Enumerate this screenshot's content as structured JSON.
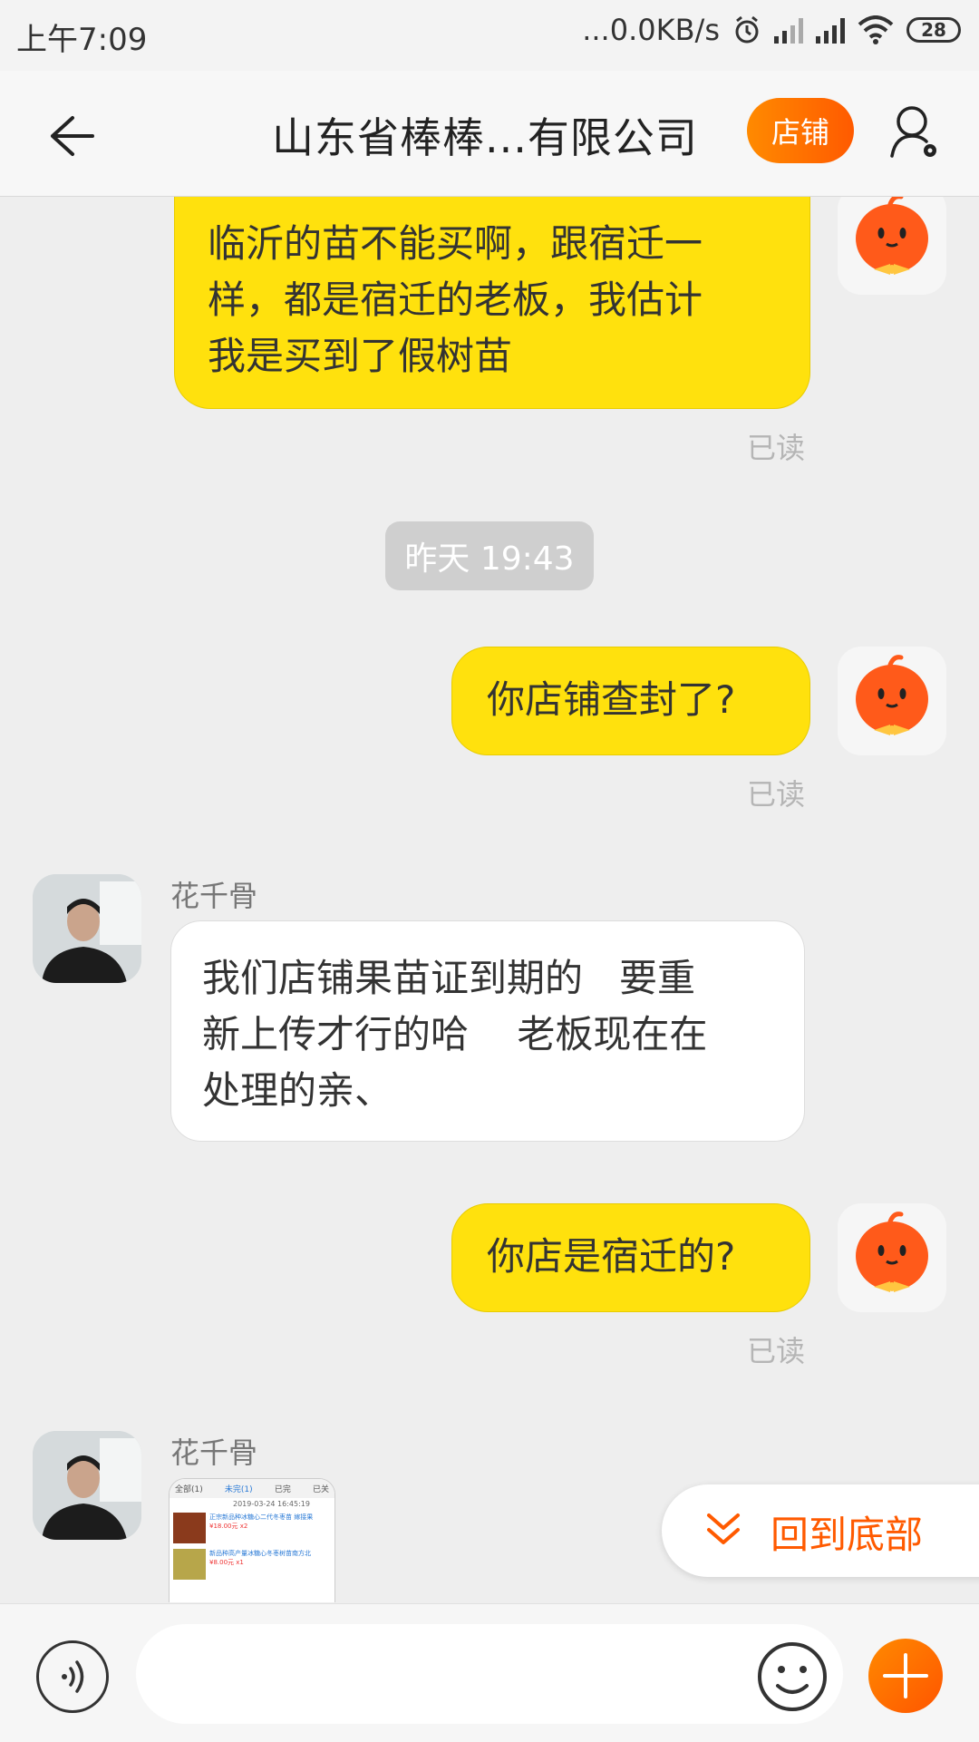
{
  "status_bar": {
    "time": "上午7:09",
    "network_speed": "...0.0KB/s",
    "battery": "28"
  },
  "header": {
    "title": "山东省棒棒...有限公司",
    "shop_label": "店铺"
  },
  "messages": [
    {
      "side": "mine",
      "text_lines": [
        "临沂的苗不能买啊，跟宿迁一",
        "样，都是宿迁的老板，我估计",
        "我是买到了假树苗"
      ],
      "read": "已读"
    },
    {
      "side": "mine",
      "text": "你店铺查封了?",
      "read": "已读"
    },
    {
      "side": "theirs",
      "sender": "花千骨",
      "text_lines": [
        "我们店铺果苗证到期的   要重",
        "新上传才行的哈    老板现在在",
        "处理的亲、"
      ]
    },
    {
      "side": "mine",
      "text": "你店是宿迁的?",
      "read": "已读"
    },
    {
      "side": "theirs",
      "sender": "花千骨",
      "type": "image"
    }
  ],
  "timestamp_divider": "昨天  19:43",
  "thumbnail": {
    "tabs": [
      "全部(1)",
      "未完(1)",
      "已完",
      "已关"
    ],
    "date": "2019-03-24 16:45:19",
    "item1": "正宗新品种冰糖心二代冬枣苗 嫁接果",
    "item1_price": "¥18.00元 x2",
    "item2": "新品种高产量冰糖心冬枣树苗南方北",
    "item2_price": "¥8.00元 x1"
  },
  "back_to_bottom_label": "回到底部",
  "input": {
    "placeholder": ""
  },
  "colors": {
    "accent": "#ff5a00",
    "bubble_mine": "#ffe10d"
  }
}
